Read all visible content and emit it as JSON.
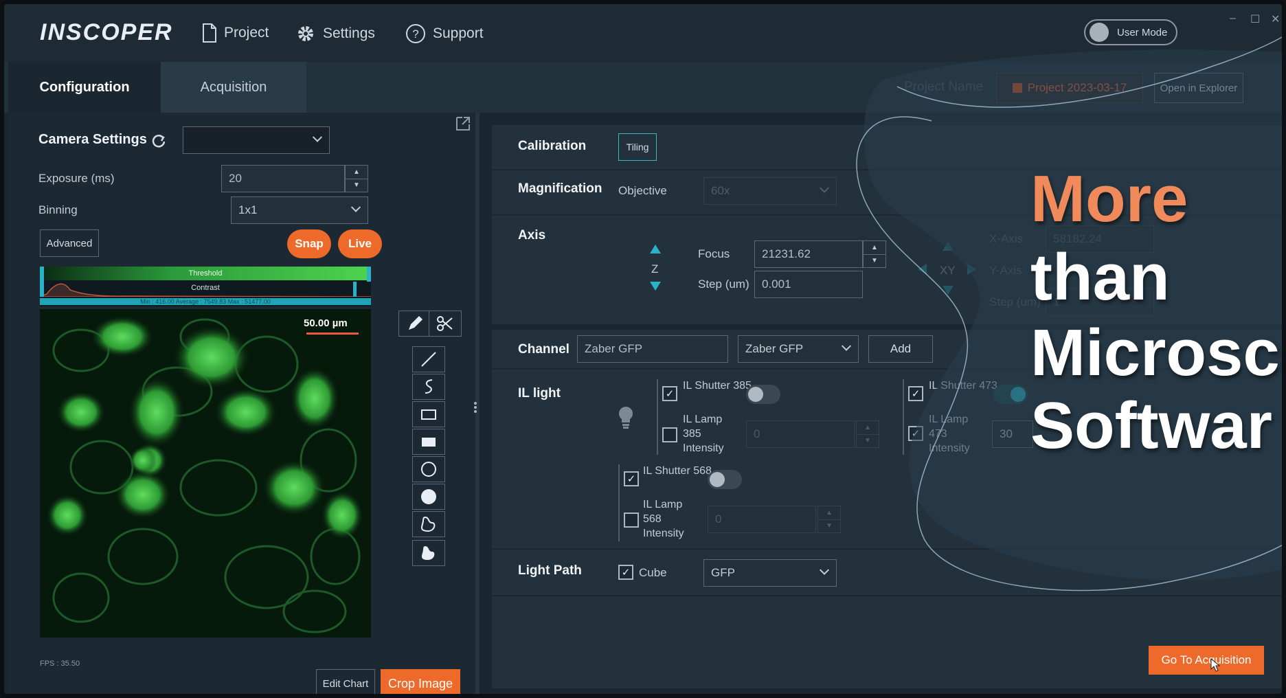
{
  "app": {
    "logo": "INSCOPER",
    "menu": [
      "Project",
      "Settings",
      "Support"
    ],
    "user_mode": "User Mode",
    "window_controls": [
      "–",
      "☐",
      "✕"
    ]
  },
  "tabs": [
    "Configuration",
    "Acquisition"
  ],
  "project": {
    "label": "Project Name",
    "value": "Project 2023-03-17",
    "open_button": "Open in Explorer"
  },
  "camera": {
    "heading": "Camera Settings",
    "camera_select": "",
    "exposure_label": "Exposure (ms)",
    "exposure_value": "20",
    "binning_label": "Binning",
    "binning_value": "1x1",
    "advanced": "Advanced",
    "snap": "Snap",
    "live": "Live",
    "threshold": "Threshold",
    "contrast": "Contrast",
    "stats": "Min : 416.00 Average : 7549.83 Max : 51477.00",
    "scale_label": "50.00 µm",
    "fps": "FPS : 35.50",
    "edit_chart": "Edit Chart",
    "crop_image": "Crop Image"
  },
  "tools": [
    "pencil-icon",
    "scissors-icon",
    "line-icon",
    "freehand-icon",
    "rectangle-icon",
    "filled-rectangle-icon",
    "circle-icon",
    "filled-circle-icon",
    "polygon-icon",
    "filled-polygon-icon"
  ],
  "config": {
    "calibration_label": "Calibration",
    "tiling": "Tiling",
    "magnification_label": "Magnification",
    "objective_label": "Objective",
    "objective_value": "60x",
    "axis_label": "Axis",
    "z_label": "Z",
    "focus_label": "Focus",
    "focus_value": "21231.62",
    "step_label": "Step (um)",
    "step_value": "0.001",
    "xy_label": "XY",
    "xaxis_label": "X-Axis",
    "xaxis_value": "58182.24",
    "yaxis_label": "Y-Axis",
    "xy_step_label": "Step (um)",
    "xy_step_value": "1",
    "channel_label": "Channel",
    "channel_name": "Zaber GFP",
    "channel_select": "Zaber GFP",
    "add": "Add",
    "illight_label": "IL light",
    "shutter385": "IL Shutter 385",
    "lamp385": "IL Lamp 385 Intensity",
    "lamp385_value": "0",
    "shutter473": "IL Shutter 473",
    "lamp473": "IL Lamp 473 Intensity",
    "lamp473_value": "30",
    "shutter568": "IL Shutter 568",
    "lamp568": "IL Lamp 568 Intensity",
    "lamp568_value": "0",
    "lightpath_label": "Light Path",
    "cube_label": "Cube",
    "cube_value": "GFP",
    "go_acquisition": "Go To Acquisition"
  },
  "headline": {
    "line1": "More",
    "line2": "than",
    "line3": "Microsc",
    "line4": "Softwar"
  },
  "colors": {
    "accent": "#ee6a2a",
    "cyan": "#2bb2c6",
    "panel": "#22313c",
    "headline_orange": "#f08a5a"
  }
}
